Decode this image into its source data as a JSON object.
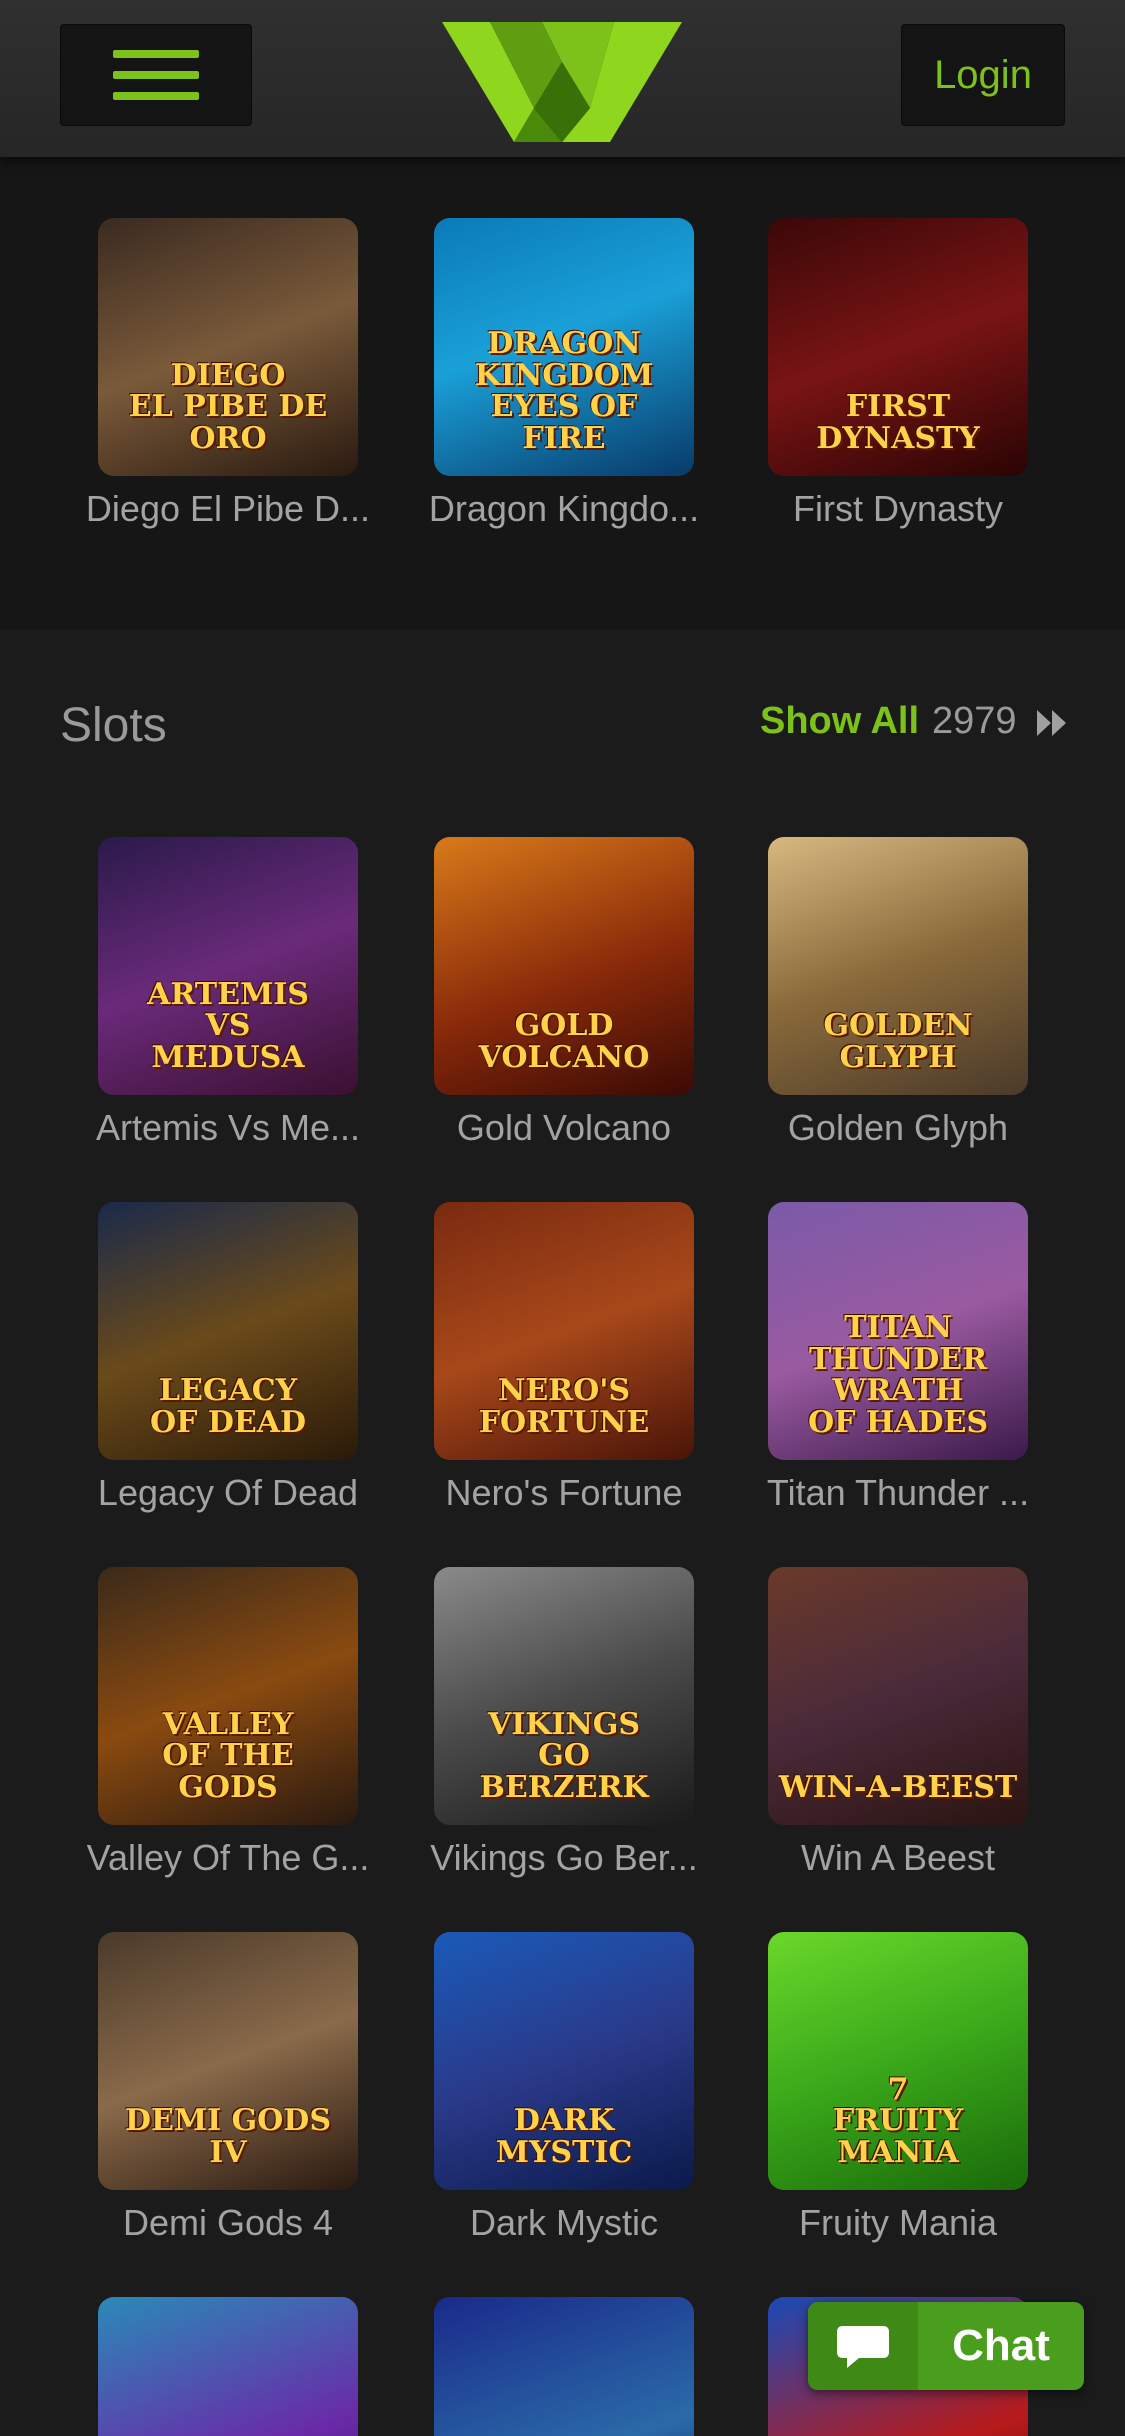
{
  "header": {
    "login_label": "Login"
  },
  "slots": {
    "title": "Slots",
    "show_all_label": "Show All",
    "count": "2979"
  },
  "top_games": [
    {
      "name": "Diego El Pibe D...",
      "art": "DIEGO\nEL PIBE DE ORO",
      "bg": "linear-gradient(160deg,#3a2a20,#7a5a3a 50%,#2a1a10)"
    },
    {
      "name": "Dragon Kingdo...",
      "art": "DRAGON KINGDOM\nEYES OF FIRE",
      "bg": "linear-gradient(160deg,#0a7ab8,#1aa0d8 45%,#083a68)"
    },
    {
      "name": "First Dynasty",
      "art": "FIRST\nDYNASTY",
      "bg": "linear-gradient(160deg,#3a0808,#7a1414 50%,#2a0404)"
    }
  ],
  "slot_games": [
    {
      "name": "Artemis Vs Me...",
      "art": "ARTEMIS\nVS\nMEDUSA",
      "bg": "linear-gradient(160deg,#2a1a4a,#6a2a7a 50%,#3a1030)"
    },
    {
      "name": "Gold Volcano",
      "art": "GOLD\nVOLCANO",
      "bg": "linear-gradient(160deg,#d87a1a,#8a2a0a 55%,#3a0a04)"
    },
    {
      "name": "Golden Glyph",
      "art": "GOLDEN GLYPH",
      "bg": "linear-gradient(160deg,#d8b880,#8a6a3a 50%,#4a3a2a)"
    },
    {
      "name": "Legacy Of Dead",
      "art": "LEGACY\nOF DEAD",
      "bg": "linear-gradient(160deg,#1a2a4a,#6a4a1a 50%,#2a1a08)"
    },
    {
      "name": "Nero's Fortune",
      "art": "NERO'S\nFORTUNE",
      "bg": "linear-gradient(160deg,#7a2a10,#a8481a 50%,#4a1408)"
    },
    {
      "name": "Titan Thunder ...",
      "art": "TITAN THUNDER\nWRATH\nOF HADES",
      "bg": "linear-gradient(160deg,#7a5aa8,#9a5aa0 50%,#3a1a4a)"
    },
    {
      "name": "Valley Of The G...",
      "art": "VALLEY\nOF THE\nGODS",
      "bg": "linear-gradient(160deg,#3a2a1a,#8a4a10 50%,#2a1a10)"
    },
    {
      "name": "Vikings Go Ber...",
      "art": "VIKINGS\nGO\nBERZERK",
      "bg": "linear-gradient(160deg,#8a8a8a,#4a4a4a 50%,#1a1a1a)"
    },
    {
      "name": "Win A Beest",
      "art": "WIN-A-BEEST",
      "bg": "linear-gradient(160deg,#6a3a2a,#4a2a3a 50%,#2a1410)"
    },
    {
      "name": "Demi Gods 4",
      "art": "DEMI GODS IV",
      "bg": "linear-gradient(160deg,#4a3a2a,#8a6a4a 50%,#2a1a10)"
    },
    {
      "name": "Dark Mystic",
      "art": "DARK MYSTIC",
      "bg": "linear-gradient(160deg,#1a5ab8,#2a3a8a 50%,#0a1a4a)"
    },
    {
      "name": "Fruity Mania",
      "art": "7\nFRUITY\nMANIA",
      "bg": "linear-gradient(160deg,#6ad82a,#3aa81a 50%,#1a6a0a)"
    },
    {
      "name": "",
      "art": "",
      "bg": "linear-gradient(160deg,#2a8ab8,#6a2aa8 60%,#3a1a6a)"
    },
    {
      "name": "",
      "art": "",
      "bg": "linear-gradient(160deg,#1a2a8a,#2a6aa8 60%,#0a1a4a)"
    },
    {
      "name": "",
      "art": "",
      "bg": "linear-gradient(160deg,#1a4ab8,#b81a1a 60%,#4a0a0a)"
    }
  ],
  "chat": {
    "label": "Chat"
  },
  "colors": {
    "accent": "#7dc11b",
    "background": "#161616",
    "chat": "#4a9e1d"
  }
}
